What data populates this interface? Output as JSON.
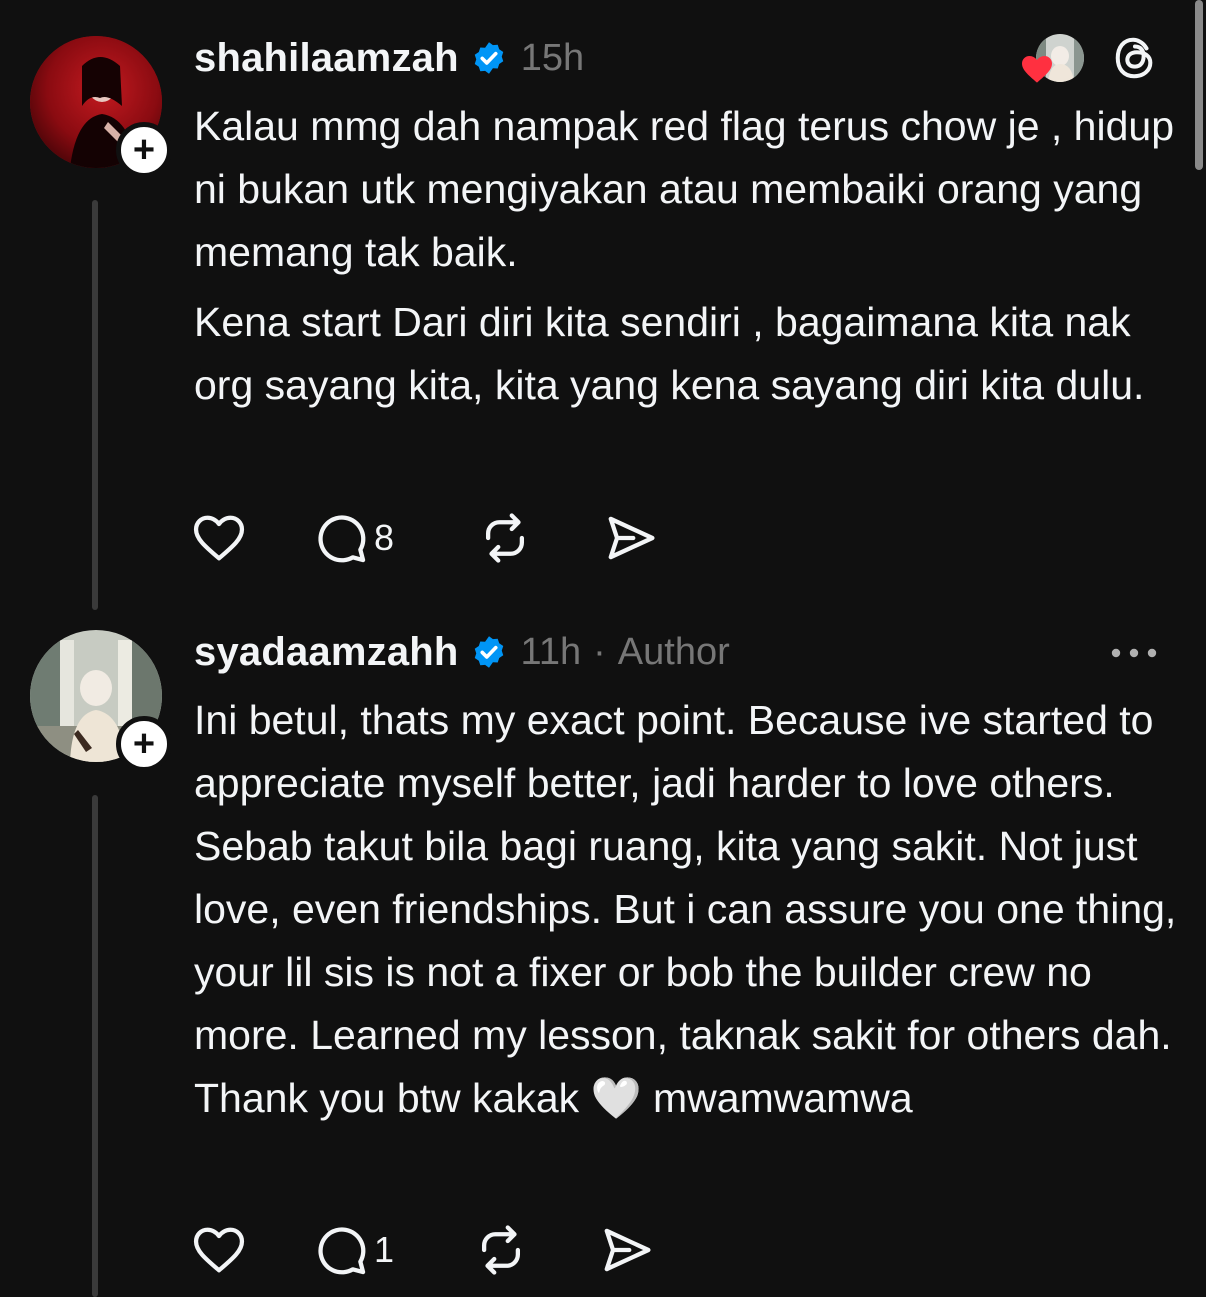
{
  "posts": [
    {
      "username": "shahilaamzah",
      "time": "15h",
      "paragraphs": [
        "Kalau mmg dah nampak red flag terus chow je , hidup ni bukan utk mengiyakan atau membaiki orang yang memang tak baik.",
        "Kena start Dari diri kita sendiri , bagaimana kita nak org sayang kita, kita yang kena sayang diri kita dulu."
      ],
      "reply_count": "8"
    },
    {
      "username": "syadaamzahh",
      "time": "11h",
      "separator": "·",
      "author_label": "Author",
      "text_before_emoji": "Ini betul, thats my exact point. Because ive started to appreciate myself better, jadi harder to love others. Sebab takut bila bagi ruang, kita yang sakit. Not just love, even friendships. But i can assure you one thing, your lil sis is not a fixer or bob the builder crew no more. Learned my lesson, taknak sakit for others dah. Thank you btw kakak",
      "emoji": "🤍",
      "text_after_emoji": "mwamwamwa",
      "reply_count": "1"
    }
  ],
  "icons": {
    "follow": "+",
    "verified": "verified-badge-icon",
    "like": "heart-icon",
    "reply": "comment-icon",
    "repost": "repost-icon",
    "share": "send-icon",
    "app_logo": "threads-logo-icon",
    "more": "more-icon"
  },
  "colors": {
    "background": "#101010",
    "text": "#f3f5f7",
    "muted": "#777777",
    "verified": "#0095f6",
    "like_heart": "#ff3040"
  }
}
